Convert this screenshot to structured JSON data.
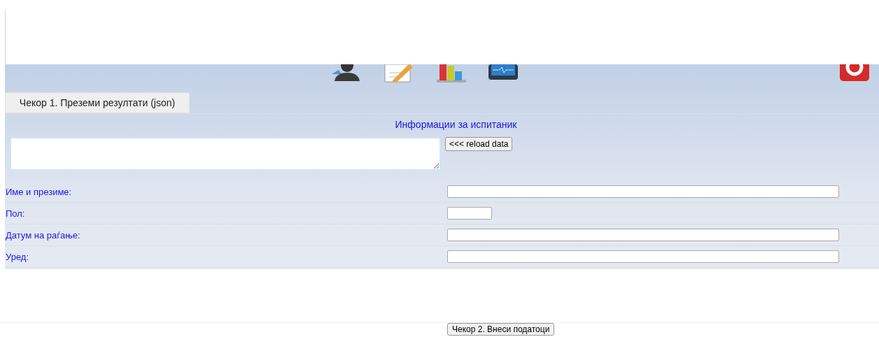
{
  "step1_button": {
    "label": "Чекор 1. Преземи резултати (json)"
  },
  "section_title": "Информации за испитаник",
  "reload_button": {
    "label": "<<< reload data"
  },
  "fields": [
    {
      "label": "Име и презиме:",
      "kind": "wide"
    },
    {
      "label": "Пол:",
      "kind": "short"
    },
    {
      "label": "Датум на раѓање:",
      "kind": "wide"
    },
    {
      "label": "Уред:",
      "kind": "wide"
    }
  ],
  "step2_button": {
    "label": "Чекор 2. Внеси податоци"
  }
}
